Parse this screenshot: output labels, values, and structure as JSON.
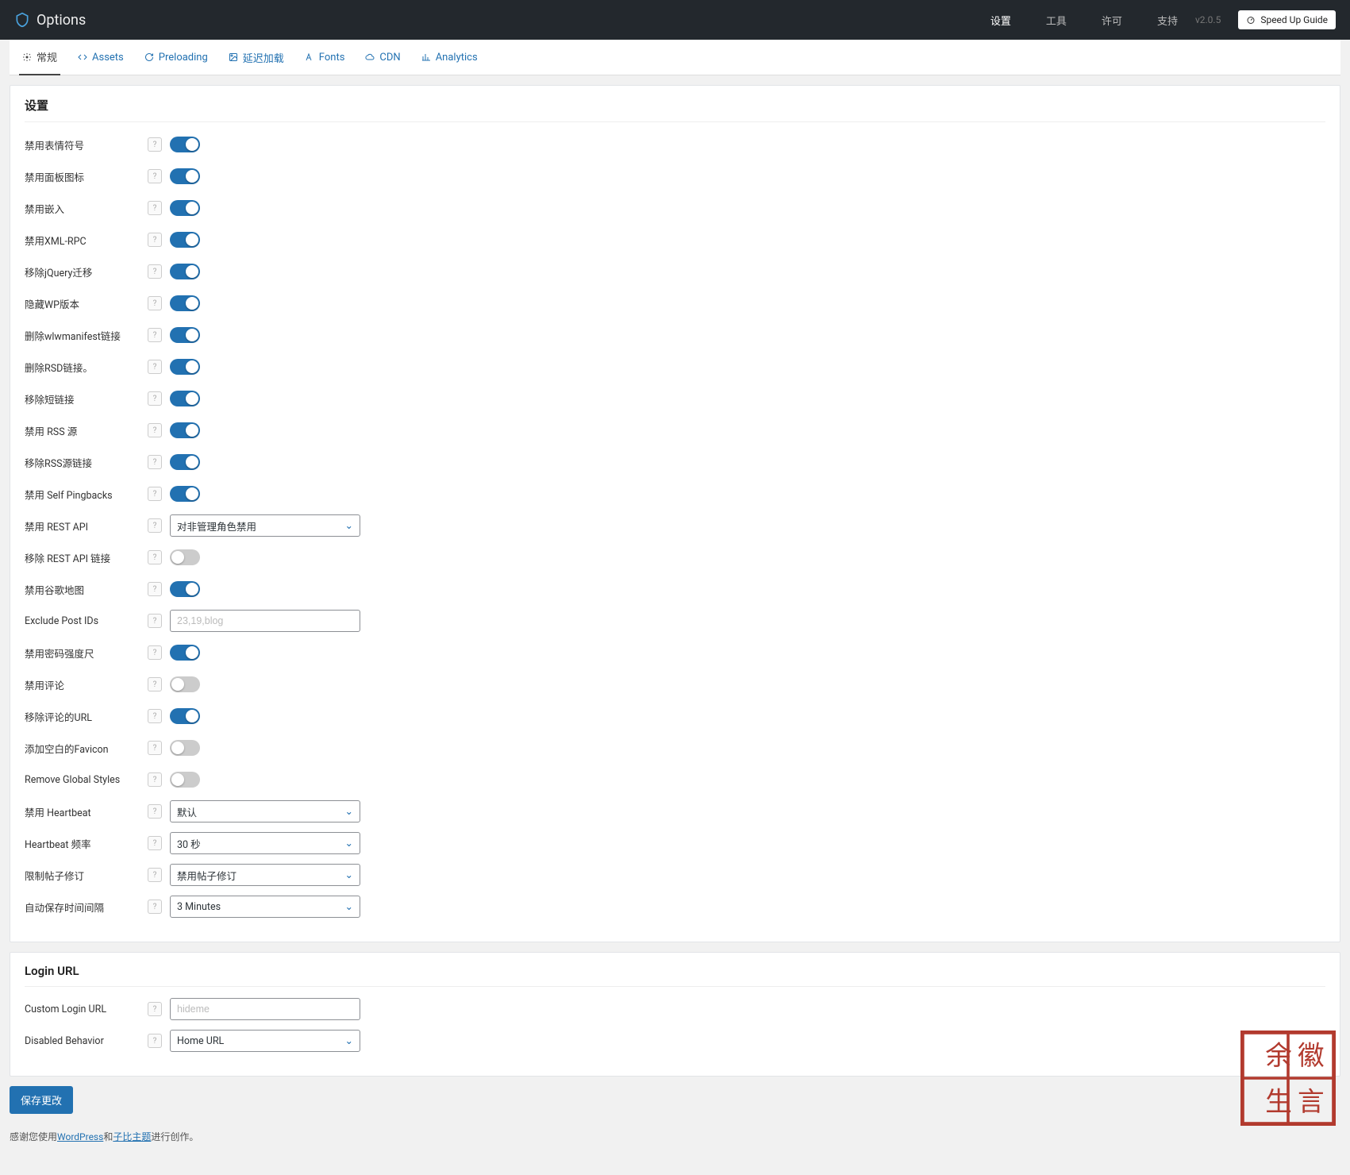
{
  "header": {
    "title": "Options",
    "nav": [
      {
        "label": "设置",
        "name": "hdr-nav-settings",
        "active": true
      },
      {
        "label": "工具",
        "name": "hdr-nav-tools",
        "active": false
      },
      {
        "label": "许可",
        "name": "hdr-nav-license",
        "active": false
      },
      {
        "label": "支持",
        "name": "hdr-nav-support",
        "active": false
      }
    ],
    "version": "v2.0.5",
    "speed_btn": "Speed Up Guide"
  },
  "tabs": [
    {
      "label": "常规",
      "name": "tab-general",
      "icon": "gear-icon",
      "active": true
    },
    {
      "label": "Assets",
      "name": "tab-assets",
      "icon": "code-icon",
      "active": false
    },
    {
      "label": "Preloading",
      "name": "tab-preloading",
      "icon": "refresh-icon",
      "active": false
    },
    {
      "label": "延迟加载",
      "name": "tab-lazyload",
      "icon": "image-icon",
      "active": false
    },
    {
      "label": "Fonts",
      "name": "tab-fonts",
      "icon": "font-icon",
      "active": false
    },
    {
      "label": "CDN",
      "name": "tab-cdn",
      "icon": "cloud-icon",
      "active": false
    },
    {
      "label": "Analytics",
      "name": "tab-analytics",
      "icon": "chart-icon",
      "active": false
    }
  ],
  "sections": {
    "settings_heading": "设置",
    "login_heading": "Login URL"
  },
  "settings": [
    {
      "key": "disable_emojis",
      "label": "禁用表情符号",
      "type": "toggle",
      "value": true
    },
    {
      "key": "disable_dashicons",
      "label": "禁用面板图标",
      "type": "toggle",
      "value": true
    },
    {
      "key": "disable_embeds",
      "label": "禁用嵌入",
      "type": "toggle",
      "value": true
    },
    {
      "key": "disable_xmlrpc",
      "label": "禁用XML-RPC",
      "type": "toggle",
      "value": true
    },
    {
      "key": "remove_jquery_migrate",
      "label": "移除jQuery迁移",
      "type": "toggle",
      "value": true
    },
    {
      "key": "hide_wp_version",
      "label": "隐藏WP版本",
      "type": "toggle",
      "value": true
    },
    {
      "key": "remove_wlwmanifest",
      "label": "删除wlwmanifest链接",
      "type": "toggle",
      "value": true
    },
    {
      "key": "remove_rsd",
      "label": "删除RSD链接。",
      "type": "toggle",
      "value": true
    },
    {
      "key": "remove_shortlink",
      "label": "移除短链接",
      "type": "toggle",
      "value": true
    },
    {
      "key": "disable_rss",
      "label": "禁用 RSS 源",
      "type": "toggle",
      "value": true
    },
    {
      "key": "remove_rss_links",
      "label": "移除RSS源链接",
      "type": "toggle",
      "value": true
    },
    {
      "key": "disable_self_pingbacks",
      "label": "禁用 Self Pingbacks",
      "type": "toggle",
      "value": true
    },
    {
      "key": "disable_rest_api",
      "label": "禁用 REST API",
      "type": "select",
      "value": "对非管理角色禁用"
    },
    {
      "key": "remove_rest_api_links",
      "label": "移除 REST API 链接",
      "type": "toggle",
      "value": false
    },
    {
      "key": "disable_google_maps",
      "label": "禁用谷歌地图",
      "type": "toggle",
      "value": true
    },
    {
      "key": "exclude_post_ids",
      "label": "Exclude Post IDs",
      "type": "text",
      "value": "",
      "placeholder": "23,19,blog"
    },
    {
      "key": "disable_pw_strength",
      "label": "禁用密码强度尺",
      "type": "toggle",
      "value": true
    },
    {
      "key": "disable_comments",
      "label": "禁用评论",
      "type": "toggle",
      "value": false
    },
    {
      "key": "remove_comment_url",
      "label": "移除评论的URL",
      "type": "toggle",
      "value": true
    },
    {
      "key": "add_blank_favicon",
      "label": "添加空白的Favicon",
      "type": "toggle",
      "value": false
    },
    {
      "key": "remove_global_styles",
      "label": "Remove Global Styles",
      "type": "toggle",
      "value": false
    },
    {
      "key": "disable_heartbeat",
      "label": "禁用 Heartbeat",
      "type": "select",
      "value": "默认"
    },
    {
      "key": "heartbeat_frequency",
      "label": "Heartbeat 频率",
      "type": "select",
      "value": "30 秒"
    },
    {
      "key": "limit_post_revisions",
      "label": "限制帖子修订",
      "type": "select",
      "value": "禁用帖子修订"
    },
    {
      "key": "autosave_interval",
      "label": "自动保存时间间隔",
      "type": "select",
      "value": "3 Minutes"
    }
  ],
  "login": [
    {
      "key": "custom_login_url",
      "label": "Custom Login URL",
      "type": "text",
      "value": "",
      "placeholder": "hideme"
    },
    {
      "key": "disabled_behavior",
      "label": "Disabled Behavior",
      "type": "select",
      "value": "Home URL"
    }
  ],
  "buttons": {
    "save": "保存更改"
  },
  "footer": {
    "pre": "感谢您使用",
    "link1": "WordPress",
    "mid": "和",
    "link2": "子比主题",
    "post": "进行创作。"
  }
}
